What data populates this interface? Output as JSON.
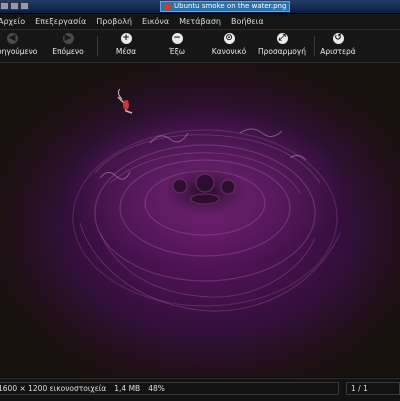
{
  "window": {
    "title": "Ubuntu smoke on the water.png"
  },
  "menu": {
    "items": [
      "Αρχείο",
      "Επεξεργασία",
      "Προβολή",
      "Εικόνα",
      "Μετάβαση",
      "Βοήθεια"
    ]
  },
  "toolbar": {
    "buttons": [
      {
        "label": "Προηγούμενο",
        "icon": "back-arrow-icon"
      },
      {
        "label": "Επόμενο",
        "icon": "forward-arrow-icon"
      },
      {
        "label": "Μέσα",
        "icon": "zoom-in-icon"
      },
      {
        "label": "Έξω",
        "icon": "zoom-out-icon"
      },
      {
        "label": "Κανονικό",
        "icon": "zoom-normal-icon"
      },
      {
        "label": "Προσαρμογή",
        "icon": "zoom-fit-icon"
      },
      {
        "label": "Αριστερά",
        "icon": "rotate-left-icon"
      }
    ]
  },
  "status": {
    "dimensions": "1600 × 1200 εικονοστοιχεία",
    "size": "1,4 MB",
    "zoom": "48%",
    "page": "1 / 1"
  },
  "colors": {
    "titlebar": "#1a3160",
    "background": "#141414",
    "image_purple": "#5c1660"
  }
}
